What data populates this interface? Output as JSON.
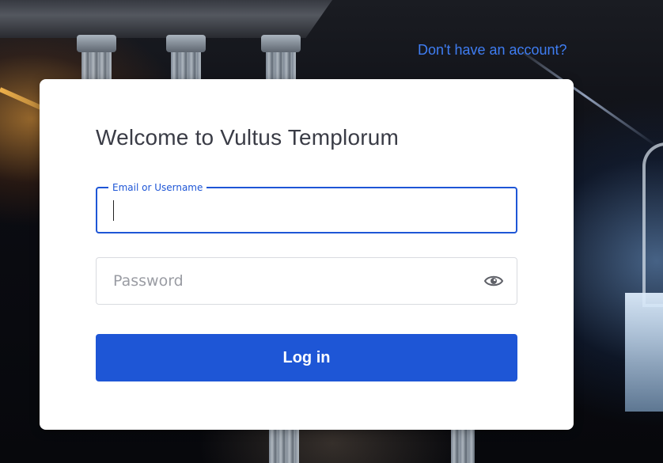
{
  "header": {
    "signup_link": "Don't have an account?"
  },
  "login_card": {
    "title": "Welcome to Vultus Templorum",
    "email_field": {
      "label": "Email or Username",
      "value": ""
    },
    "password_field": {
      "placeholder": "Password",
      "value": "",
      "toggle_icon": "eye-icon"
    },
    "login_button": "Log in"
  },
  "colors": {
    "accent": "#1e56d6",
    "link": "#3f7df2",
    "title_text": "#3a3c46",
    "placeholder_text": "#9a9ca3"
  }
}
